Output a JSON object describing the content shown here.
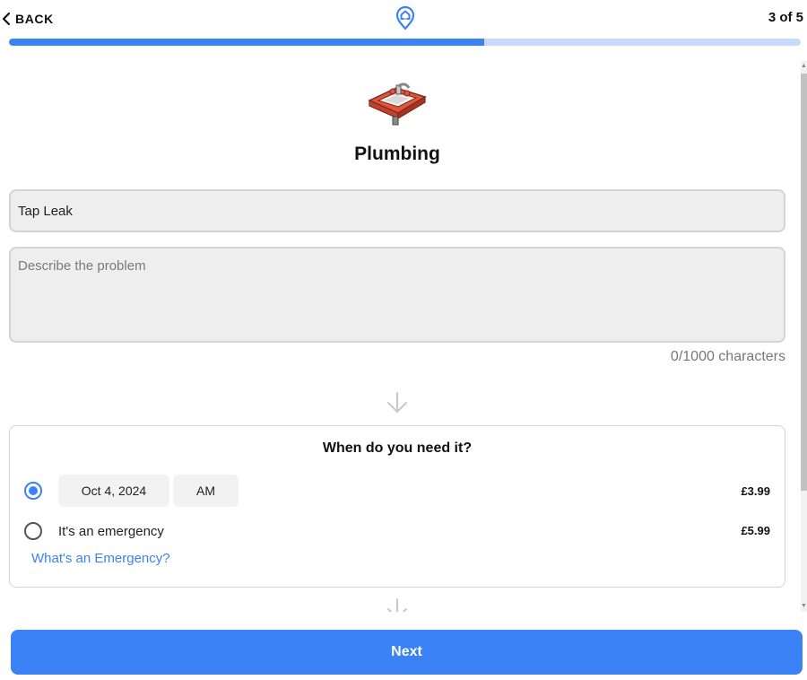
{
  "header": {
    "back_label": "BACK",
    "step_text": "3 of 5",
    "progress_fraction": 0.6
  },
  "category": {
    "icon": "sink-icon",
    "title": "Plumbing"
  },
  "form": {
    "job_title_value": "Tap Leak",
    "description_value": "",
    "description_placeholder": "Describe the problem",
    "char_count": "0/1000 characters"
  },
  "schedule": {
    "heading": "When do you need it?",
    "options": [
      {
        "selected": true,
        "date": "Oct 4, 2024",
        "period": "AM",
        "price": "£3.99"
      },
      {
        "selected": false,
        "label": "It's an emergency",
        "price": "£5.99"
      }
    ],
    "emergency_link": "What's an Emergency?"
  },
  "footer": {
    "next_label": "Next"
  },
  "colors": {
    "accent": "#3b82f6",
    "progress_track": "#c6dafd",
    "field_bg": "#eeeeee"
  }
}
